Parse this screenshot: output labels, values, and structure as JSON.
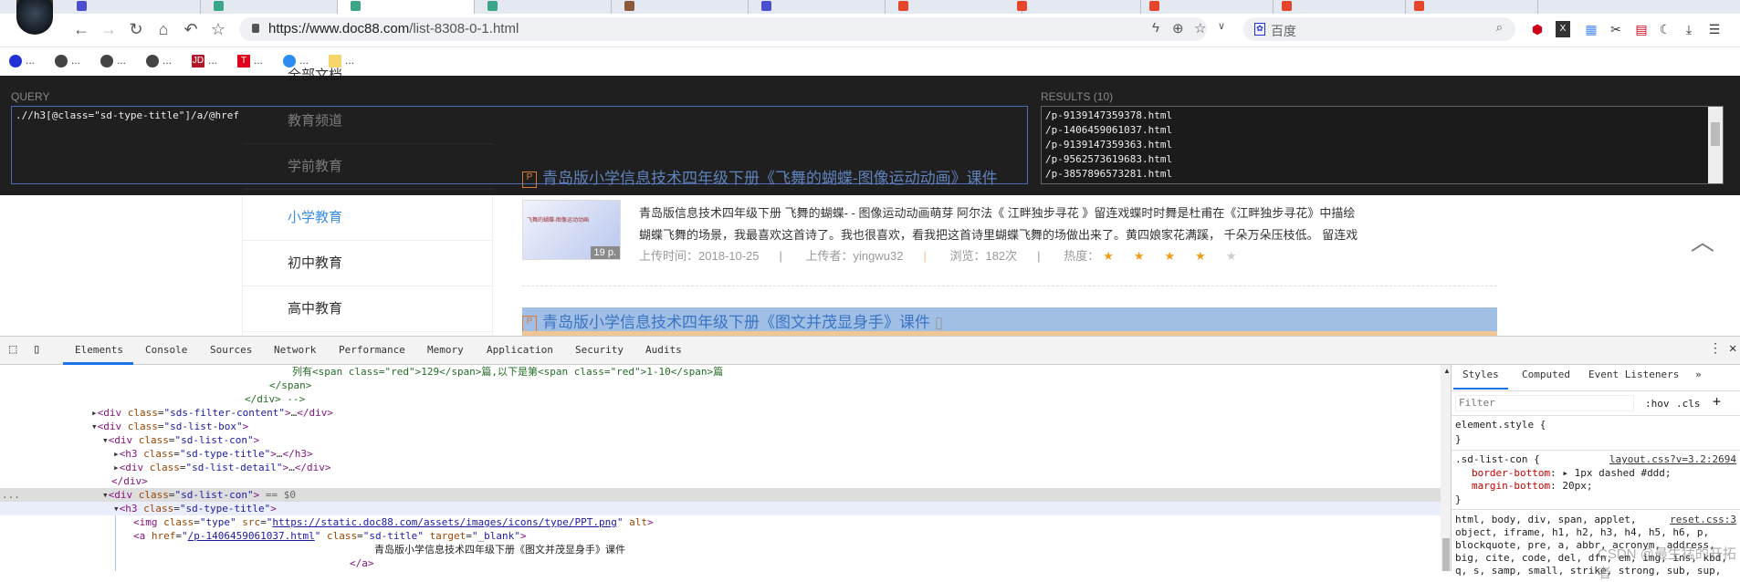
{
  "browser": {
    "url_host": "https://www.doc88.com",
    "url_path": "/list-8308-0-1.html",
    "search_engine": "百度",
    "bookmarks_label": "...",
    "tab_icon_colors": [
      "#4a4fd0",
      "#3ba58a",
      "#3ba58a",
      "#3ba58a",
      "#8a5a3a",
      "#4a4fd0",
      "#e5452b",
      "#e5452b",
      "#e5452b",
      "#e5452b",
      "#e5452b"
    ]
  },
  "xpath_helper": {
    "query_label": "QUERY",
    "query": ".//h3[@class=\"sd-type-title\"]/a/@href",
    "results_label": "RESULTS (10)",
    "results": [
      "/p-9139147359378.html",
      "/p-1406459061037.html",
      "/p-9139147359363.html",
      "/p-9562573619683.html",
      "/p-3857896573281.html"
    ]
  },
  "page": {
    "hidden_sidebar": [
      "全部文档",
      "教育频道",
      "学前教育"
    ],
    "sidebar": [
      "小学教育",
      "初中教育",
      "高中教育"
    ],
    "active_sidebar": "小学教育",
    "doc1": {
      "title": "青岛版小学信息技术四年级下册《飞舞的蝴蝶-图像运动动画》课件",
      "thumb_caption": "飞舞的蝴蝶-图像运动动画",
      "pages": "19 p.",
      "desc_line1": "青岛版信息技术四年级下册 飞舞的蝴蝶- - 图像运动动画萌芽 阿尔法《 江畔独步寻花 》留连戏蝶时时舞是杜甫在《江畔独步寻花》中描绘",
      "desc_line2": "蝴蝶飞舞的场景，我最喜欢这首诗了。我也很喜欢，看我把这首诗里蝴蝶飞舞的场做出来了。黄四娘家花满蹊， 千朵万朵压枝低。 留连戏",
      "upload_time": "上传时间：2018-10-25",
      "uploader": "上传者：yingwu32",
      "views": "浏览：182次",
      "heat_label": "热度：",
      "rating": 4,
      "rating_max": 5
    },
    "doc2": {
      "title": "青岛版小学信息技术四年级下册《图文并茂显身手》课件"
    },
    "file_icon": "P"
  },
  "devtools": {
    "tabs": [
      "Elements",
      "Console",
      "Sources",
      "Network",
      "Performance",
      "Memory",
      "Application",
      "Security",
      "Audits"
    ],
    "active_tab": "Elements",
    "tree": {
      "r0": "列有<span class=\"red\">129</span>篇,以下是第<span class=\"red\">1-10</span>篇",
      "r1": "</span>",
      "r2": "</div> -->",
      "r3_class": "sds-filter-content",
      "r4_class": "sd-list-box",
      "r5_class": "sd-list-con",
      "r6_class": "sd-type-title",
      "r7_class": "sd-list-detail",
      "r8": "</div>",
      "r9_class": "sd-list-con",
      "r9_suffix": " == $0",
      "r10_class": "sd-type-title",
      "r11_class": "type",
      "r11_src": "https://static.doc88.com/assets/images/icons/type/PPT.png",
      "r12_href": "/p-1406459061037.html",
      "r12_class": "sd-title",
      "r12_target": "_blank",
      "r13": "青岛版小学信息技术四年级下册《图文并茂显身手》课件",
      "r14": "</a>",
      "ellipsis": "..."
    },
    "styles": {
      "tabs": [
        "Styles",
        "Computed",
        "Event Listeners",
        "»"
      ],
      "filter_placeholder": "Filter",
      "hov": ":hov",
      "cls": ".cls",
      "plus": "+",
      "element_style": "element.style {",
      "close": "}",
      "rule_selector": ".sd-list-con {",
      "rule_source": "layout.css?v=3.2:2694",
      "prop1": "border-bottom",
      "val1": "1px dashed #ddd;",
      "prop2": "margin-bottom",
      "val2": "20px;",
      "reset_source": "reset.css:3",
      "reset_lines": [
        "html, body, div, span, applet,",
        "object, iframe, h1, h2, h3, h4, h5, h6, p,",
        "blockquote, pre, a, abbr, acronym, address,",
        "big, cite, code, del, dfn, em, img, ins, kbd,",
        "q, s, samp, small, strike, strong, sub, sup,"
      ]
    },
    "watermark": "CSDN @最生猛的开拓者"
  }
}
